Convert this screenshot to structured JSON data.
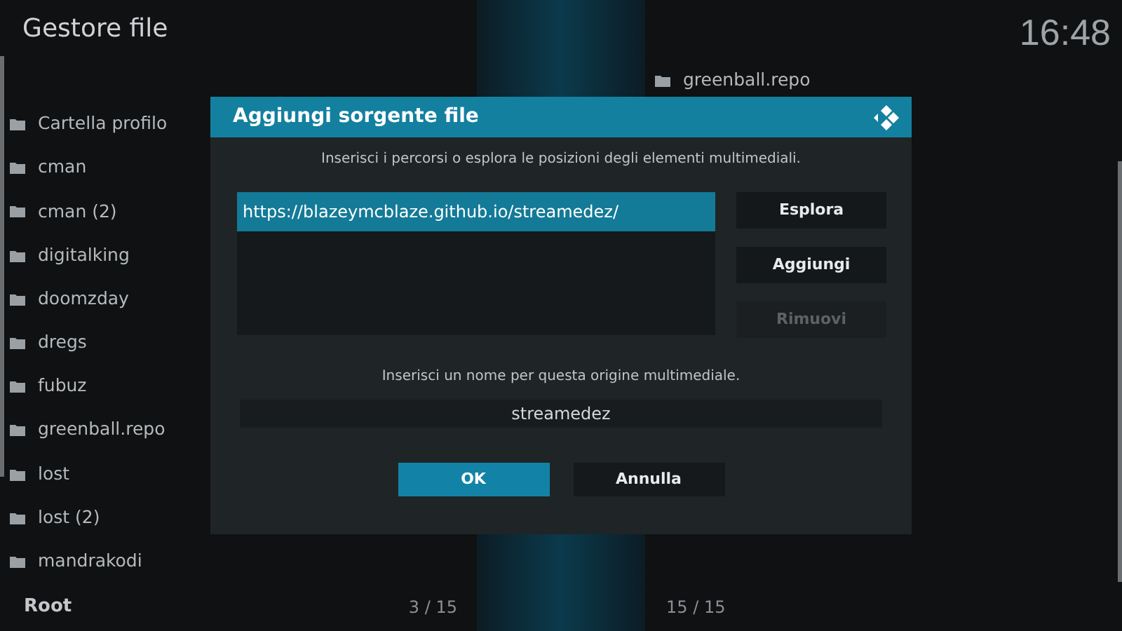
{
  "header": {
    "title": "Gestore file",
    "clock": "16:48"
  },
  "left_pane": {
    "items": [
      {
        "label": "Cartella profilo"
      },
      {
        "label": "cman"
      },
      {
        "label": "cman (2)"
      },
      {
        "label": "digitalking"
      },
      {
        "label": "doomzday"
      },
      {
        "label": "dregs"
      },
      {
        "label": "fubuz"
      },
      {
        "label": "greenball.repo"
      },
      {
        "label": "lost"
      },
      {
        "label": "lost (2)"
      },
      {
        "label": "mandrakodi"
      }
    ],
    "footer_path": "Root",
    "footer_count": "3 / 15"
  },
  "right_pane": {
    "items": [
      {
        "label": "greenball.repo"
      }
    ],
    "footer_count": "15 / 15"
  },
  "dialog": {
    "title": "Aggiungi sorgente file",
    "instruction": "Inserisci i percorsi o esplora le posizioni degli elementi multimediali.",
    "paths": [
      {
        "label": "https://blazeymcblaze.github.io/streamedez/",
        "selected": true
      }
    ],
    "buttons": [
      {
        "label": "Esplora",
        "disabled": false
      },
      {
        "label": "Aggiungi",
        "disabled": false
      },
      {
        "label": "Rimuovi",
        "disabled": true
      }
    ],
    "name_prompt": "Inserisci un nome per questa origine multimediale.",
    "name_value": "streamedez",
    "actions": [
      {
        "label": "OK",
        "selected": true
      },
      {
        "label": "Annulla",
        "selected": false
      }
    ]
  }
}
